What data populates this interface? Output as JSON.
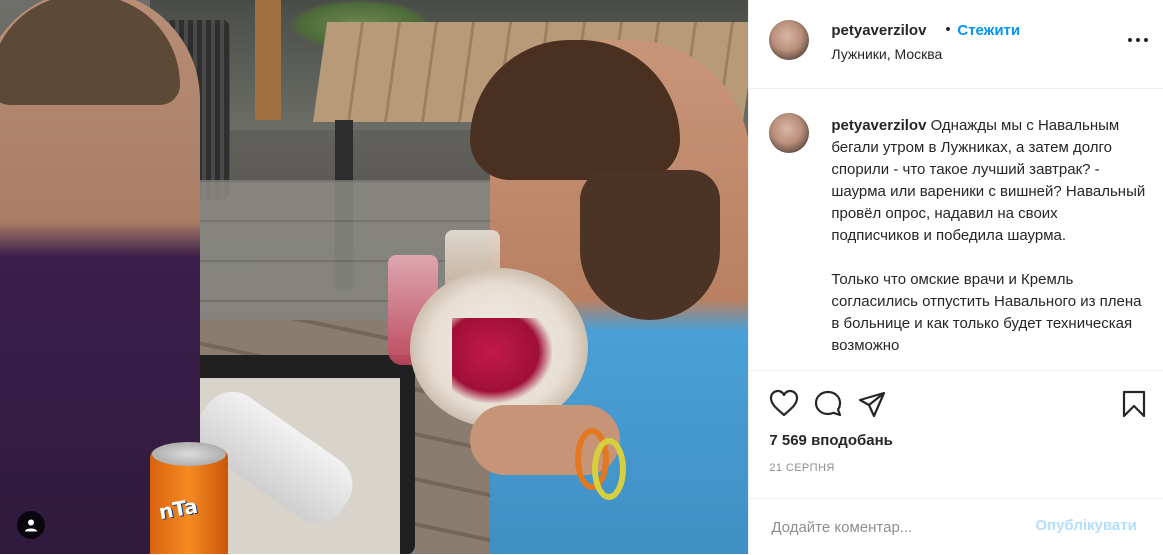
{
  "post": {
    "photo": {
      "alt_icon": "user-tag-icon",
      "can_text": "nTa"
    },
    "header": {
      "username": "petyaverzilov",
      "separator": "•",
      "follow_label": "Стежити",
      "location": "Лужники, Москва",
      "more_icon": "more-options-icon"
    },
    "caption": {
      "username": "petyaverzilov",
      "text": " Однажды мы с Навальным бегали утром в Лужниках, а затем долго спорили - что такое лучший завтрак? - шаурма или вареники с вишней? Навальный провёл опрос, надавил на своих подписчиков и победила шаурма.\n\nТолько что омские врачи и Кремль согласились отпустить Навального из плена в больнице и как только будет техническая возможно"
    },
    "actions": {
      "like_icon": "heart-icon",
      "comment_icon": "comment-icon",
      "share_icon": "send-icon",
      "save_icon": "bookmark-icon",
      "likes_text": "7 569 вподобань",
      "date_text": "21 серпня"
    },
    "comment": {
      "placeholder": "Додайте коментар...",
      "publish_label": "Опублікувати"
    },
    "colors": {
      "accent": "#0095f6",
      "publish_disabled": "#b2dffc",
      "text": "#262626",
      "muted": "#8e8e8e",
      "border": "#efefef"
    }
  }
}
